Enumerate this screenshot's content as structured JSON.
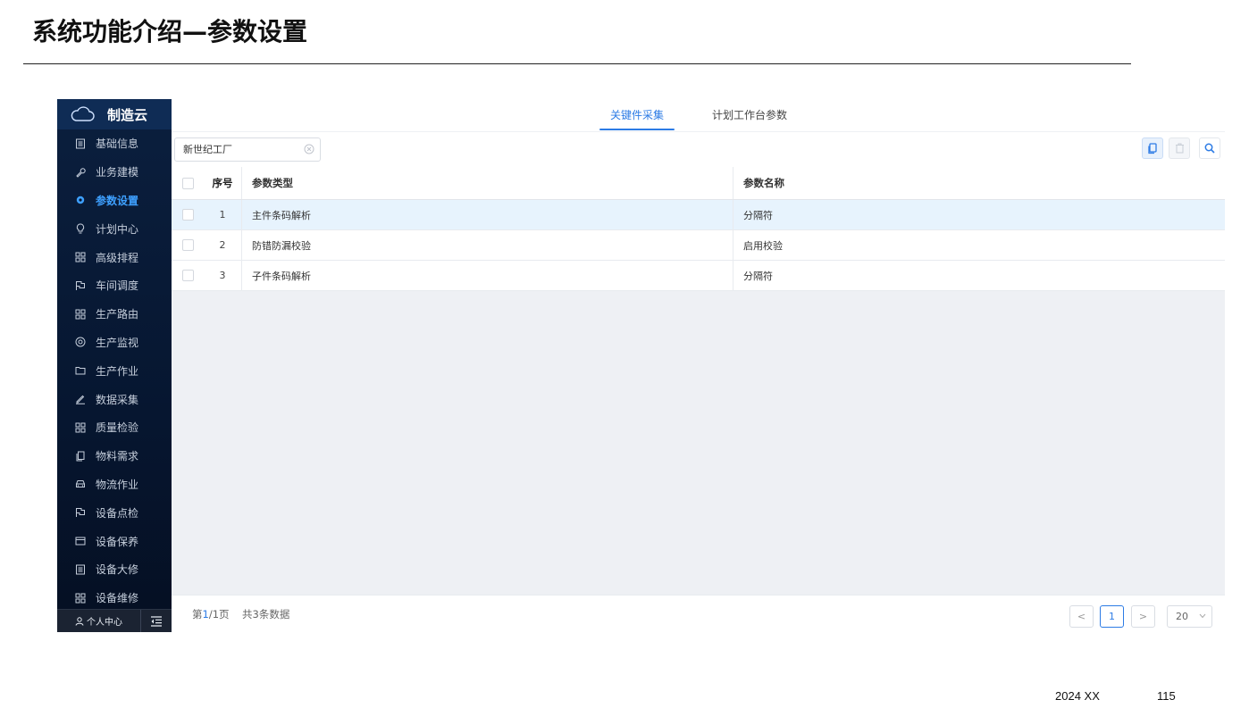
{
  "slide": {
    "title": "系统功能介绍—参数设置",
    "footer_date": "2024 XX",
    "footer_page": "115"
  },
  "brand": {
    "name": "制造云",
    "icon": "cloud-icon"
  },
  "sidebar": {
    "items": [
      {
        "label": "基础信息",
        "icon": "document-icon",
        "active": false
      },
      {
        "label": "业务建模",
        "icon": "wrench-icon",
        "active": false
      },
      {
        "label": "参数设置",
        "icon": "gear-icon",
        "active": true
      },
      {
        "label": "计划中心",
        "icon": "bulb-icon",
        "active": false
      },
      {
        "label": "高级排程",
        "icon": "grid-icon",
        "active": false
      },
      {
        "label": "车间调度",
        "icon": "flag-icon",
        "active": false
      },
      {
        "label": "生产路由",
        "icon": "grid-icon",
        "active": false
      },
      {
        "label": "生产监视",
        "icon": "location-icon",
        "active": false
      },
      {
        "label": "生产作业",
        "icon": "folder-icon",
        "active": false
      },
      {
        "label": "数据采集",
        "icon": "pen-icon",
        "active": false
      },
      {
        "label": "质量检验",
        "icon": "grid-icon",
        "active": false
      },
      {
        "label": "物料需求",
        "icon": "copy-icon",
        "active": false
      },
      {
        "label": "物流作业",
        "icon": "car-icon",
        "active": false
      },
      {
        "label": "设备点检",
        "icon": "flag-icon",
        "active": false
      },
      {
        "label": "设备保养",
        "icon": "card-icon",
        "active": false
      },
      {
        "label": "设备大修",
        "icon": "document-icon",
        "active": false
      },
      {
        "label": "设备维修",
        "icon": "grid-icon",
        "active": false
      }
    ],
    "footer_user_label": "个人中心"
  },
  "tabs": [
    {
      "label": "关键件采集",
      "active": true
    },
    {
      "label": "计划工作台参数",
      "active": false
    }
  ],
  "toolbar": {
    "factory_value": "新世纪工厂",
    "buttons": [
      "copy-icon",
      "delete-icon",
      "search-icon"
    ]
  },
  "table": {
    "columns": [
      "序号",
      "参数类型",
      "参数名称"
    ],
    "rows": [
      {
        "no": "1",
        "type": "主件条码解析",
        "name": "分隔符",
        "selected": true
      },
      {
        "no": "2",
        "type": "防错防漏校验",
        "name": "启用校验",
        "selected": false
      },
      {
        "no": "3",
        "type": "子件条码解析",
        "name": "分隔符",
        "selected": false
      }
    ]
  },
  "pager": {
    "page_prefix": "第",
    "current_page": "1",
    "page_suffix": "/1页",
    "total_text": "共3条数据",
    "prev": "<",
    "next": ">",
    "page_button": "1",
    "page_size": "20"
  },
  "colors": {
    "accent": "#2c7be5",
    "sidebar_bg": "#061630",
    "active_menu": "#3ea0ff",
    "selected_row": "#e7f3fd"
  }
}
